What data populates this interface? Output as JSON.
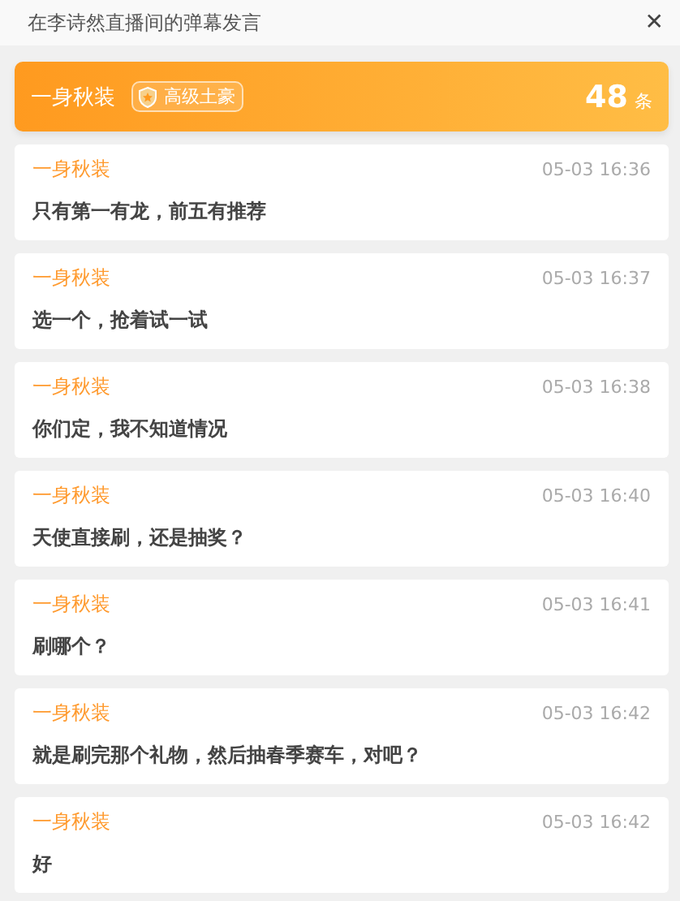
{
  "window": {
    "title": "在李诗然直播间的弹幕发言",
    "close": "✕"
  },
  "user": {
    "name": "一身秋装",
    "badge": "高级土豪",
    "count": "48",
    "unit": "条"
  },
  "messages": [
    {
      "name": "一身秋装",
      "time": "05-03 16:36",
      "text": "只有第一有龙，前五有推荐"
    },
    {
      "name": "一身秋装",
      "time": "05-03 16:37",
      "text": "选一个，抢着试一试"
    },
    {
      "name": "一身秋装",
      "time": "05-03 16:38",
      "text": "你们定，我不知道情况"
    },
    {
      "name": "一身秋装",
      "time": "05-03 16:40",
      "text": "天使直接刷，还是抽奖？"
    },
    {
      "name": "一身秋装",
      "time": "05-03 16:41",
      "text": "刷哪个？"
    },
    {
      "name": "一身秋装",
      "time": "05-03 16:42",
      "text": "就是刷完那个礼物，然后抽春季赛车，对吧？"
    },
    {
      "name": "一身秋装",
      "time": "05-03 16:42",
      "text": "好"
    }
  ]
}
